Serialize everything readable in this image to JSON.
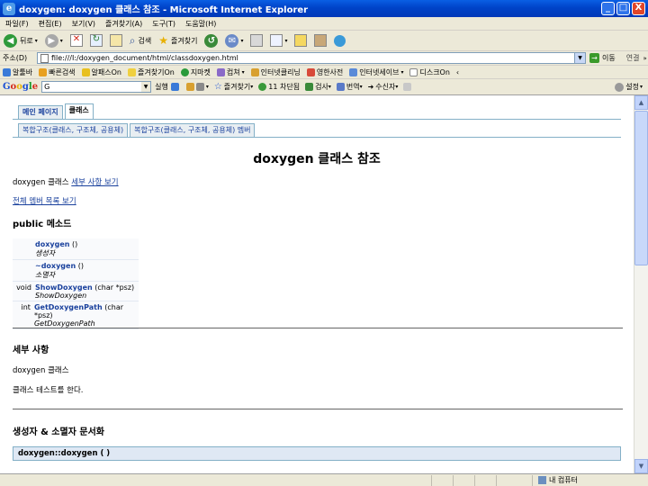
{
  "window": {
    "title": "doxygen: doxygen 클래스 참조 - Microsoft Internet Explorer",
    "controls": [
      "_",
      "□",
      "X"
    ]
  },
  "menu": [
    "파일(F)",
    "편집(E)",
    "보기(V)",
    "즐겨찾기(A)",
    "도구(T)",
    "도움말(H)"
  ],
  "toolbar": {
    "back": "뒤로",
    "search": "검색",
    "favorites": "즐겨찾기"
  },
  "address": {
    "label": "주소(D)",
    "url": "file:///I:/doxygen_document/html/classdoxygen.html",
    "go": "이동",
    "links": "연결"
  },
  "links_bar": [
    "알툴바",
    "빠른검색",
    "알패스On",
    "즐겨찾기On",
    "지마켓",
    "컴쳐",
    "인터넷클리닝",
    "영한사전",
    "인터넷세이브",
    "디스크On",
    "‹"
  ],
  "google_bar": {
    "search_value": "G",
    "items": [
      "실행",
      "",
      "즐겨찾기",
      "11 차단됨",
      "검사",
      "번역",
      "수신자"
    ],
    "settings": "설정"
  },
  "page": {
    "tabs_main": [
      "메인 페이지",
      "클래스"
    ],
    "tabs_sub": [
      "복합구조(클래스, 구조체, 공용체)",
      "복합구조(클래스, 구조체, 공용체) 멤버"
    ],
    "title": "doxygen 클래스 참조",
    "class_line_prefix": "doxygen 클래스",
    "detail_link": "세부 사항 보기",
    "all_members_link": "전체 멤버 목록 보기",
    "public_methods_heading": "public 메소드",
    "members": [
      {
        "ret": "",
        "name": "doxygen",
        "args": " ()",
        "brief": "생성자"
      },
      {
        "ret": "",
        "name": "~doxygen",
        "args": " ()",
        "brief": "소멸자"
      },
      {
        "ret": "void",
        "name": "ShowDoxygen",
        "args": " (char *psz)",
        "brief": "ShowDoxygen"
      },
      {
        "ret": "int",
        "name": "GetDoxygenPath",
        "args": " (char *psz)",
        "brief": "GetDoxygenPath"
      }
    ],
    "details_heading": "세부 사항",
    "details_text1": "doxygen 클래스",
    "details_text2": "클래스 테스트를 한다.",
    "ctor_heading": "생성자 & 소멸자 문서화",
    "ctor_proto": "doxygen::doxygen (  )"
  },
  "status": {
    "zone": "내 컴퓨터"
  }
}
